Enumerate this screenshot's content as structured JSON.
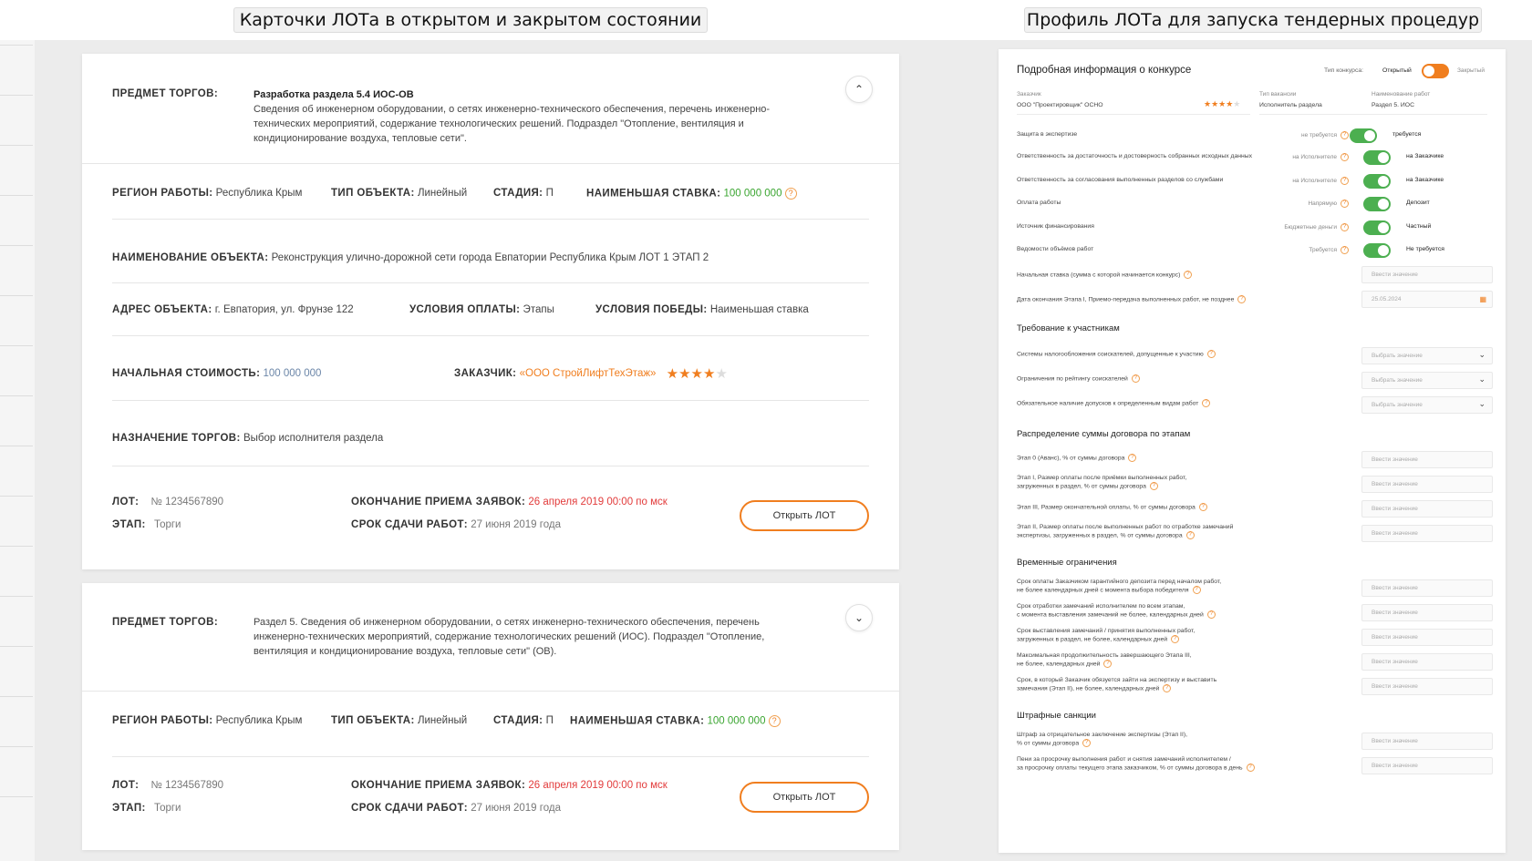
{
  "headings": {
    "left": "Карточки ЛОТа в открытом и закрытом состоянии",
    "right": "Профиль ЛОТа для запуска тендерных процедур"
  },
  "labels": {
    "subject": "ПРЕДМЕТ ТОРГОВ:",
    "region": "РЕГИОН РАБОТЫ:",
    "object_type": "ТИП ОБЪЕКТА:",
    "stage_short": "СТАДИЯ:",
    "min_bid": "НАИМЕНЬШАЯ СТАВКА:",
    "object_name": "НАИМЕНОВАНИЕ ОБЪЕКТА:",
    "address": "АДРЕС ОБЪЕКТА:",
    "payment_terms": "УСЛОВИЯ ОПЛАТЫ:",
    "win_terms": "УСЛОВИЯ ПОБЕДЫ:",
    "initial_cost": "НАЧАЛЬНАЯ СТОИМОСТЬ:",
    "customer": "ЗАКАЗЧИК:",
    "purpose": "НАЗНАЧЕНИЕ ТОРГОВ:",
    "lot": "ЛОТ:",
    "phase": "ЭТАП:",
    "deadline": "ОКОНЧАНИЕ ПРИЕМА ЗАЯВОК:",
    "delivery": "СРОК СДАЧИ РАБОТ:"
  },
  "card1": {
    "subject_title": "Разработка раздела 5.4 ИОС-ОВ",
    "subject_text": "Сведения об инженерном оборудовании, о сетях инженерно-технического обеспечения, перечень инженерно-технических мероприятий, содержание технологических решений. Подраздел \"Отопление, вентиляция и кондиционирование воздуха, тепловые сети\".",
    "region": "Республика Крым",
    "object_type": "Линейный",
    "stage": "П",
    "min_bid": "100 000 000",
    "object_name": "Реконструкция улично-дорожной сети города Евпатории Республика Крым ЛОТ 1 ЭТАП 2",
    "address": "г. Евпатория, ул. Фрунзе 122",
    "payment_terms": "Этапы",
    "win_terms": "Наименьшая ставка",
    "initial_cost": "100 000 000",
    "customer": "«ООО СтройЛифтТехЭтаж»",
    "rating": 4,
    "purpose": "Выбор исполнителя раздела",
    "lot": "№ 1234567890",
    "phase": "Торги",
    "deadline": "26 апреля 2019 00:00 по мск",
    "delivery": "27 июня 2019 года",
    "button": "Открыть ЛОТ",
    "chevron": "⌃"
  },
  "card2": {
    "subject_text": "Раздел 5. Сведения об инженерном оборудовании, о сетях инженерно-технического обеспечения, перечень инженерно-технических мероприятий, содержание технологических решений (ИОС). Подраздел \"Отопление, вентиляция и кондиционирование воздуха, тепловые сети\" (ОВ).",
    "region": "Республика Крым",
    "object_type": "Линейный",
    "stage": "П",
    "min_bid": "100 000 000",
    "lot": "№ 1234567890",
    "phase": "Торги",
    "deadline": "26 апреля 2019 00:00 по мск",
    "delivery": "27 июня 2019 года",
    "button": "Открыть ЛОТ",
    "chevron": "⌄"
  },
  "profile": {
    "title": "Подробная информация о конкурсе",
    "contest_type_label": "Тип конкурса:",
    "contest_open": "Открытый",
    "contest_closed": "Закрытый",
    "customer_label": "Заказчик",
    "customer_value": "ООО \"Проектировщик\" ОСНО",
    "vacancy_label": "Тип вакансии",
    "vacancy_value": "Исполнитель раздела",
    "work_label": "Наименование работ",
    "work_value": "Раздел 5. ИОС",
    "toggles": [
      {
        "label": "Защита в экспертизе",
        "left": "не требуется",
        "right": "требуется"
      },
      {
        "label": "Ответственность за достаточность и достоверность собранных исходных данных",
        "left": "на Исполнителе",
        "right": "на Заказчике"
      },
      {
        "label": "Ответственность за согласования выполненных разделов со службами",
        "left": "на Исполнителе",
        "right": "на Заказчике"
      },
      {
        "label": "Оплата работы",
        "left": "Напрямую",
        "right": "Депозит"
      },
      {
        "label": "Источник финансирования",
        "left": "Бюджетные деньги",
        "right": "Частный"
      },
      {
        "label": "Ведомости объёмов работ",
        "left": "Требуется",
        "right": "Не требуется"
      }
    ],
    "start_bid_label": "Начальная ставка (сумма с которой начинается конкурс)",
    "start_bid_placeholder": "Ввести значение",
    "end_date_label": "Дата окончания Этапа I, Приемо-передача выполненных работ, не позднее",
    "end_date_value": "25.05.2024",
    "req_title": "Требование к участникам",
    "requirements": [
      "Системы налогообложения соискателей, допущенные к участию",
      "Ограничения по рейтингу соискателей",
      "Обязательное наличие допусков к определенным видам работ"
    ],
    "select_placeholder": "Выбрать значение",
    "dist_title": "Распределение суммы договора по этапам",
    "distribution": [
      [
        "Этап 0 (Аванс), % от суммы договора"
      ],
      [
        "Этап I, Размер оплаты после приёмки выполненных работ,",
        "загруженных в раздел, % от суммы договора"
      ],
      [
        "Этап III, Размер окончательной оплаты, % от суммы договора"
      ],
      [
        "Этап II, Размер оплаты после выполненных работ по отработке замечаний",
        "экспертизы, загруженных в раздел, % от суммы договора"
      ]
    ],
    "time_title": "Временные ограничения",
    "time_limits": [
      [
        "Срок оплаты Заказчиком гарантийного депозита перед началом работ,",
        "не более календарных дней с момента выбора победителя"
      ],
      [
        "Срок отработки замечаний исполнителем по всем этапам,",
        "с момента выставления замечаний не более, календарных дней"
      ],
      [
        "Срок выставления замечаний / принятия выполненных работ,",
        "загруженных в раздел, не более, календарных дней"
      ],
      [
        "Максимальная продолжительность завершающего Этапа III,",
        "не более, календарных дней"
      ],
      [
        "Срок, в который Заказчик обязуется зайти на экспертизу и выставить",
        "замечания (Этап II), не более, календарных дней"
      ]
    ],
    "fines_title": "Штрафные санкции",
    "fines": [
      [
        "Штраф за отрицательное заключение экспертизы (Этап II),",
        "% от суммы договора"
      ],
      [
        "Пени за просрочку выполнения работ и снятия замечаний исполнителем /",
        "за просрочку оплаты текущего этапа заказчиком, % от суммы договора в день"
      ]
    ],
    "input_placeholder": "Ввести значение",
    "q": "?"
  },
  "colors": {
    "accent": "#f07e1f",
    "green": "#3aa530",
    "red": "#e23b3b",
    "toggle_on": "#4caf50"
  }
}
